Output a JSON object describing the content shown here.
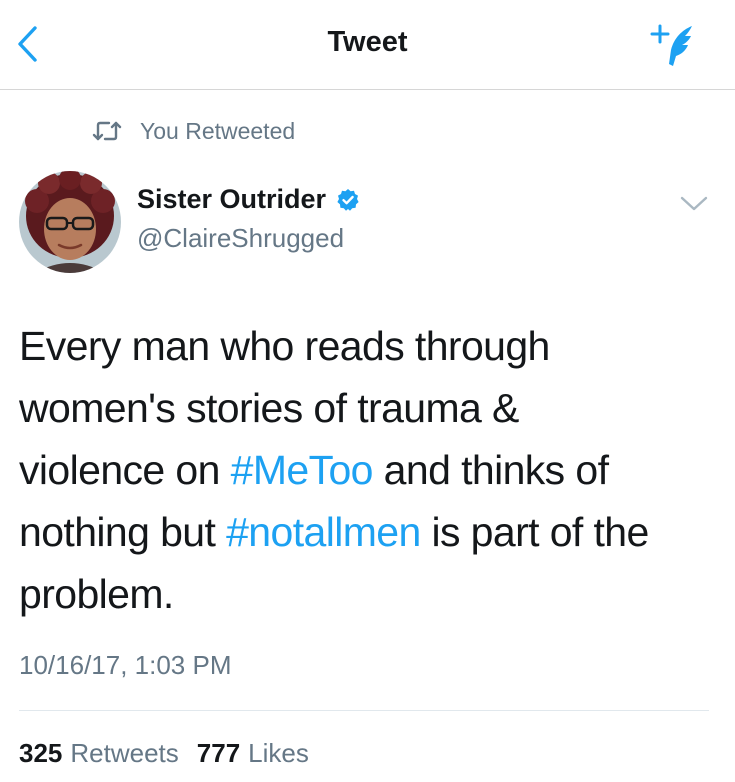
{
  "navbar": {
    "title": "Tweet",
    "back_icon": "chevron-left-icon",
    "compose_icon": "compose-feather-icon"
  },
  "social_context": {
    "icon": "retweet-icon",
    "label": "You Retweeted"
  },
  "author": {
    "name": "Sister Outrider",
    "handle": "@ClaireShrugged",
    "verified": true
  },
  "tweet": {
    "lines": [
      [
        {
          "text": "Every man who reads through",
          "hashtag": false
        }
      ],
      [
        {
          "text": "women's stories of trauma &",
          "hashtag": false
        }
      ],
      [
        {
          "text": "violence on ",
          "hashtag": false
        },
        {
          "text": "#MeToo",
          "hashtag": true
        },
        {
          "text": " and thinks of",
          "hashtag": false
        }
      ],
      [
        {
          "text": "nothing but ",
          "hashtag": false
        },
        {
          "text": "#notallmen",
          "hashtag": true
        },
        {
          "text": " is part of the",
          "hashtag": false
        }
      ],
      [
        {
          "text": "problem.",
          "hashtag": false
        }
      ]
    ],
    "timestamp": "10/16/17, 1:03 PM"
  },
  "stats": {
    "retweets_count": "325",
    "retweets_label": "Retweets",
    "likes_count": "777",
    "likes_label": "Likes"
  },
  "colors": {
    "accent": "#1da1f2",
    "secondary_text": "#657786",
    "primary_text": "#14171a",
    "divider": "#e1e8ed"
  }
}
